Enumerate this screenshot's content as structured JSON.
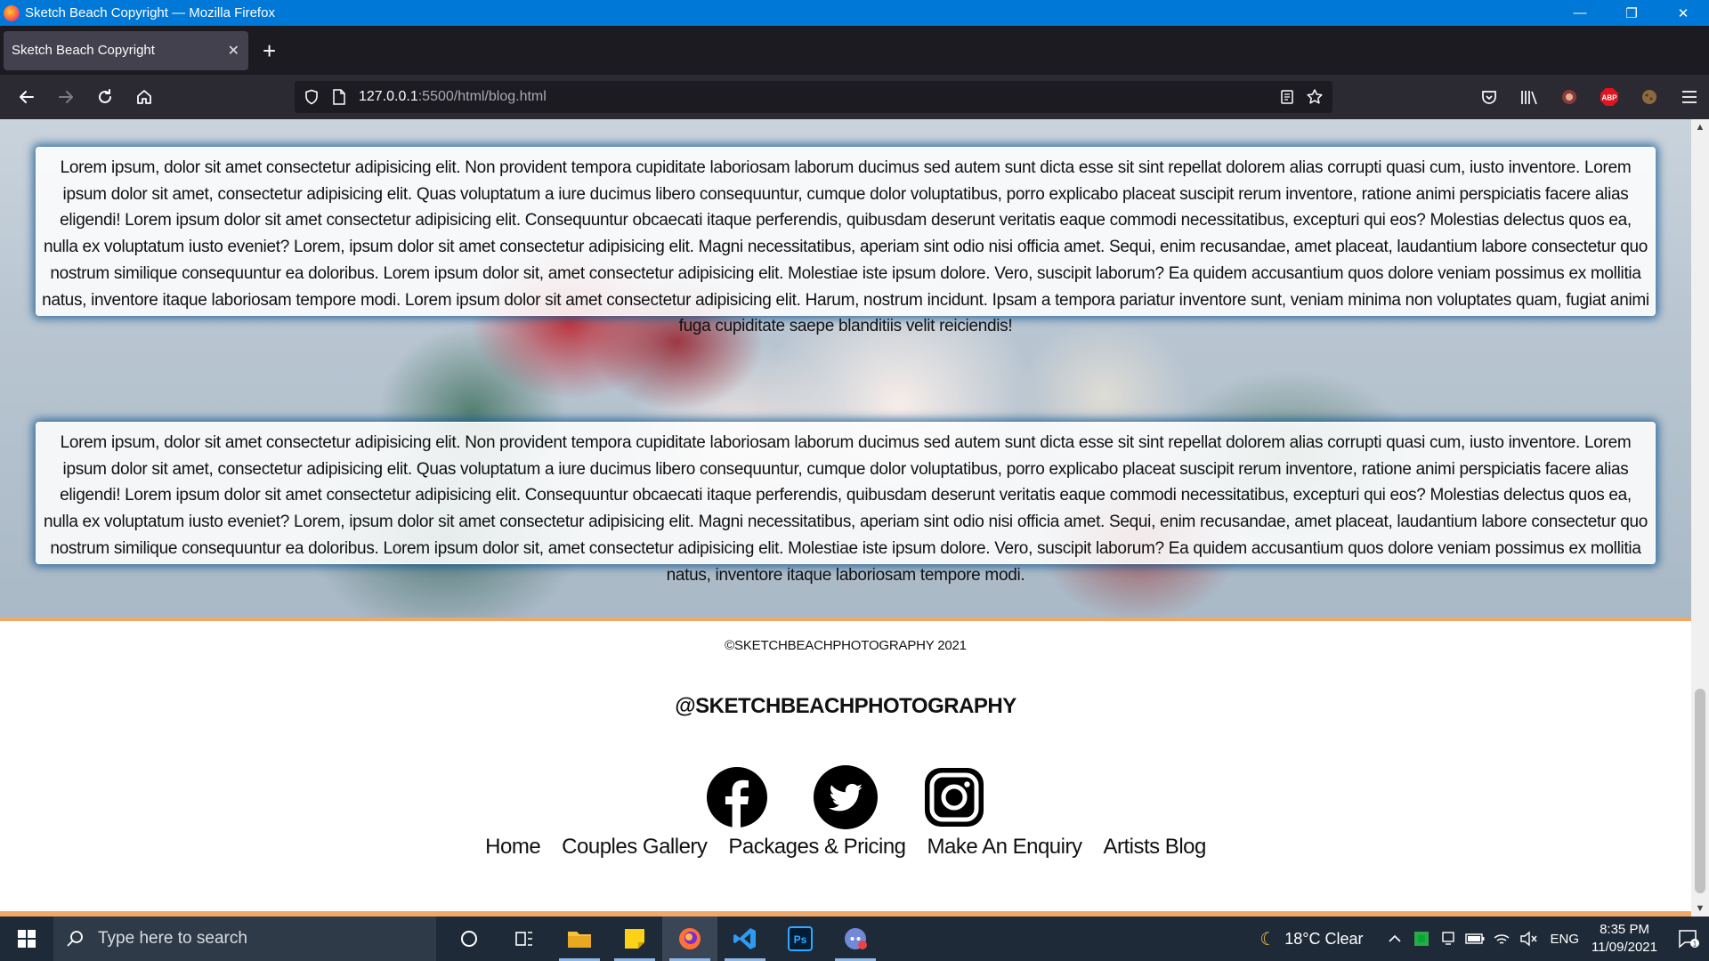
{
  "window": {
    "title": "Sketch Beach Copyright — Mozilla Firefox",
    "minimize_glyph": "—",
    "restore_glyph": "❐",
    "close_glyph": "✕"
  },
  "tabs": [
    {
      "label": "Sketch Beach Copyright",
      "close_glyph": "✕"
    }
  ],
  "new_tab_glyph": "+",
  "urlbar": {
    "host": "127.0.0.1",
    "path": ":5500/html/blog.html"
  },
  "page": {
    "paragraph_1": "Lorem ipsum, dolor sit amet consectetur adipisicing elit. Non provident tempora cupiditate laboriosam laborum ducimus sed autem sunt dicta esse sit sint repellat dolorem alias corrupti quasi cum, iusto inventore. Lorem ipsum dolor sit amet, consectetur adipisicing elit. Quas voluptatum a iure ducimus libero consequuntur, cumque dolor voluptatibus, porro explicabo placeat suscipit rerum inventore, ratione animi perspiciatis facere alias eligendi! Lorem ipsum dolor sit amet consectetur adipisicing elit. Consequuntur obcaecati itaque perferendis, quibusdam deserunt veritatis eaque commodi necessitatibus, excepturi qui eos? Molestias delectus quos ea, nulla ex voluptatum iusto eveniet? Lorem, ipsum dolor sit amet consectetur adipisicing elit. Magni necessitatibus, aperiam sint odio nisi officia amet. Sequi, enim recusandae, amet placeat, laudantium labore consectetur quo nostrum similique consequuntur ea doloribus. Lorem ipsum dolor sit, amet consectetur adipisicing elit. Molestiae iste ipsum dolore. Vero, suscipit laborum? Ea quidem accusantium quos dolore veniam possimus ex mollitia natus, inventore itaque laboriosam tempore modi. Lorem ipsum dolor sit amet consectetur adipisicing elit. Harum, nostrum incidunt. Ipsam a tempora pariatur inventore sunt, veniam minima non voluptates quam, fugiat animi fuga cupiditate saepe blanditiis velit reiciendis!",
    "paragraph_2": "Lorem ipsum, dolor sit amet consectetur adipisicing elit. Non provident tempora cupiditate laboriosam laborum ducimus sed autem sunt dicta esse sit sint repellat dolorem alias corrupti quasi cum, iusto inventore. Lorem ipsum dolor sit amet, consectetur adipisicing elit. Quas voluptatum a iure ducimus libero consequuntur, cumque dolor voluptatibus, porro explicabo placeat suscipit rerum inventore, ratione animi perspiciatis facere alias eligendi! Lorem ipsum dolor sit amet consectetur adipisicing elit. Consequuntur obcaecati itaque perferendis, quibusdam deserunt veritatis eaque commodi necessitatibus, excepturi qui eos? Molestias delectus quos ea, nulla ex voluptatum iusto eveniet? Lorem, ipsum dolor sit amet consectetur adipisicing elit. Magni necessitatibus, aperiam sint odio nisi officia amet. Sequi, enim recusandae, amet placeat, laudantium labore consectetur quo nostrum similique consequuntur ea doloribus. Lorem ipsum dolor sit, amet consectetur adipisicing elit. Molestiae iste ipsum dolore. Vero, suscipit laborum? Ea quidem accusantium quos dolore veniam possimus ex mollitia natus, inventore itaque laboriosam tempore modi.",
    "copyright": "©SKETCHBEACHPHOTOGRAPHY 2021",
    "handle": "@SKETCHBEACHPHOTOGRAPHY",
    "socials": [
      {
        "icon": "facebook-icon"
      },
      {
        "icon": "twitter-icon"
      },
      {
        "icon": "instagram-icon"
      }
    ],
    "footer_nav": [
      "Home",
      "Couples Gallery",
      "Packages & Pricing",
      "Make An Enquiry",
      "Artists Blog"
    ]
  },
  "taskbar": {
    "search_placeholder": "Type here to search",
    "weather": "18°C  Clear",
    "language": "ENG",
    "time": "8:35 PM",
    "date": "11/09/2021",
    "notification_count": "1"
  },
  "colors": {
    "titlebar": "#0078d7",
    "accent_border": "#f0a868",
    "box_glow": "#0a508c"
  }
}
